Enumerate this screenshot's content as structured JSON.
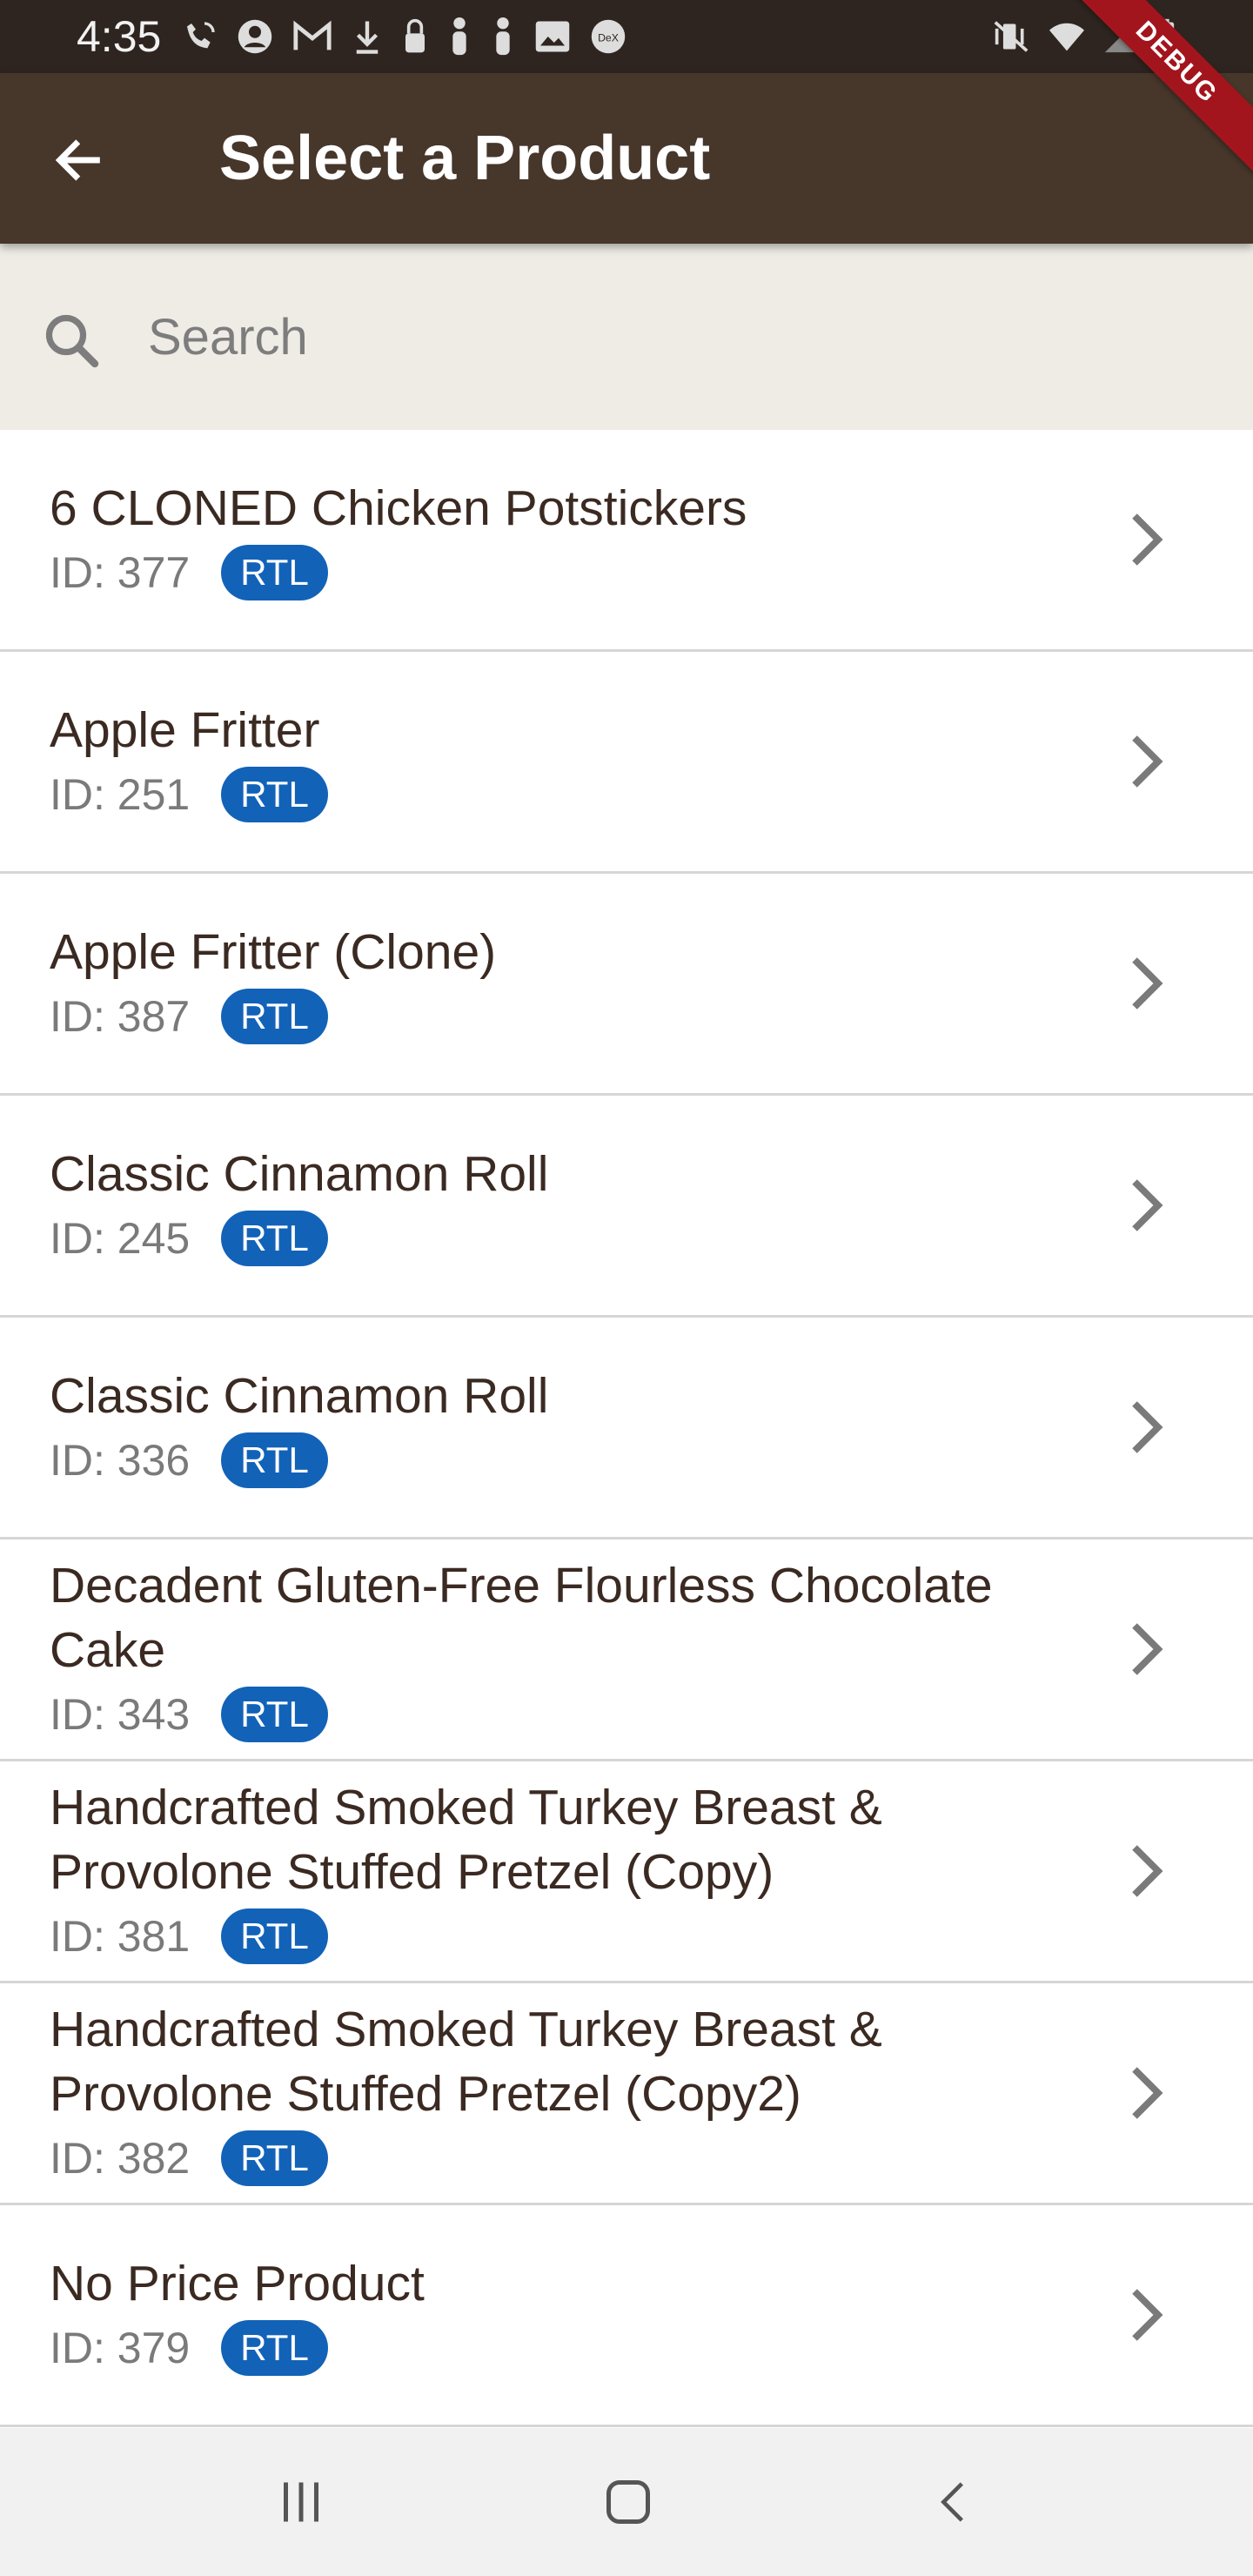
{
  "status_bar": {
    "time": "4:35",
    "left_icons": [
      "wifi-calling-icon",
      "account-circle-icon",
      "gmail-icon",
      "download-icon",
      "lock-icon",
      "person-icon",
      "person-icon",
      "image-icon",
      "dex-icon"
    ],
    "dex_label": "DeX",
    "right_icons": [
      "vibrate-mute-icon",
      "wifi-icon",
      "signal-icon",
      "battery-charging-icon"
    ]
  },
  "debug_ribbon": {
    "label": "DEBUG"
  },
  "app_bar": {
    "title": "Select a Product",
    "back_icon": "arrow-back-icon"
  },
  "search": {
    "placeholder": "Search",
    "value": "",
    "icon": "search-icon"
  },
  "products": [
    {
      "name": "6 CLONED Chicken Potstickers",
      "id_text": "ID: 377",
      "badge": "RTL"
    },
    {
      "name": "Apple Fritter",
      "id_text": "ID: 251",
      "badge": "RTL"
    },
    {
      "name": "Apple Fritter (Clone)",
      "id_text": "ID: 387",
      "badge": "RTL"
    },
    {
      "name": "Classic Cinnamon Roll",
      "id_text": "ID: 245",
      "badge": "RTL"
    },
    {
      "name": "Classic Cinnamon Roll",
      "id_text": "ID: 336",
      "badge": "RTL"
    },
    {
      "name": "Decadent Gluten-Free Flourless Chocolate Cake",
      "id_text": "ID: 343",
      "badge": "RTL"
    },
    {
      "name": "Handcrafted Smoked Turkey Breast & Provolone Stuffed Pretzel (Copy)",
      "id_text": "ID: 381",
      "badge": "RTL"
    },
    {
      "name": "Handcrafted Smoked Turkey Breast & Provolone Stuffed Pretzel (Copy2)",
      "id_text": "ID: 382",
      "badge": "RTL"
    },
    {
      "name": "No Price Product",
      "id_text": "ID: 379",
      "badge": "RTL"
    }
  ],
  "nav_bar": {
    "buttons": [
      "recent-apps-icon",
      "home-icon",
      "back-icon"
    ]
  },
  "colors": {
    "status_bar": "#2e2520",
    "app_bar": "#47362a",
    "search_bg": "#efece6",
    "badge": "#1262b8",
    "debug": "#a3151c",
    "divider": "#d6d6d6"
  }
}
